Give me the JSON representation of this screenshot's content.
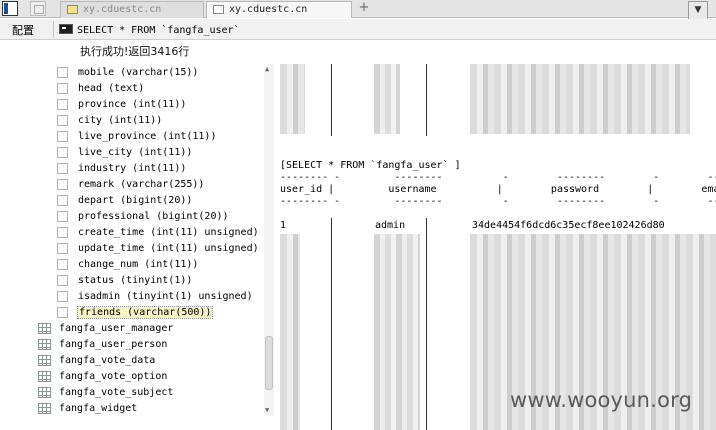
{
  "tabs": [
    {
      "label": "xy.cduestc.cn",
      "active": false
    },
    {
      "label": "xy.cduestc.cn",
      "active": true
    }
  ],
  "new_tab_label": "+",
  "menu_arrow": "▼",
  "toolbar": {
    "config_label": "配置",
    "query": "SELECT * FROM `fangfa_user`"
  },
  "status_text": "执行成功!返回3416行",
  "tree": {
    "fields": [
      "mobile (varchar(15))",
      "head (text)",
      "province (int(11))",
      "city (int(11))",
      "live_province (int(11))",
      "live_city (int(11))",
      "industry (int(11))",
      "remark (varchar(255))",
      "depart (bigint(20))",
      "professional (bigint(20))",
      "create_time (int(11) unsigned)",
      "update_time (int(11) unsigned)",
      "change_num (int(11))",
      "status (tinyint(1))",
      "isadmin (tinyint(1) unsigned)",
      "friends (varchar(500))"
    ],
    "selected_field": "friends (varchar(500))",
    "tables": [
      "fangfa_user_manager",
      "fangfa_user_person",
      "fangfa_vote_data",
      "fangfa_vote_option",
      "fangfa_vote_subject",
      "fangfa_widget"
    ]
  },
  "result": {
    "query_echo": "[SELECT * FROM `fangfa_user` ]",
    "dash_line_1": "-------- -         --------          -        --------        -        -----    -",
    "header_line": "user_id |         username          |        password        |        email    |",
    "dash_line_2": "-------- -         --------          -        --------        -        -----    -",
    "first_row": {
      "user_id": "1",
      "username": "admin",
      "password": "34de4454f6dcd6c35ecf8ee102426d80"
    }
  },
  "watermark": "www.wooyun.org",
  "colors": {
    "selected_bg": "#f7f1c4",
    "toolbar_bg": "#f1f1f1",
    "tab_bar_bg": "#e4e4e4"
  },
  "icons": [
    "app-icon",
    "tab-page-icon",
    "console-icon",
    "field-icon",
    "table-icon"
  ]
}
